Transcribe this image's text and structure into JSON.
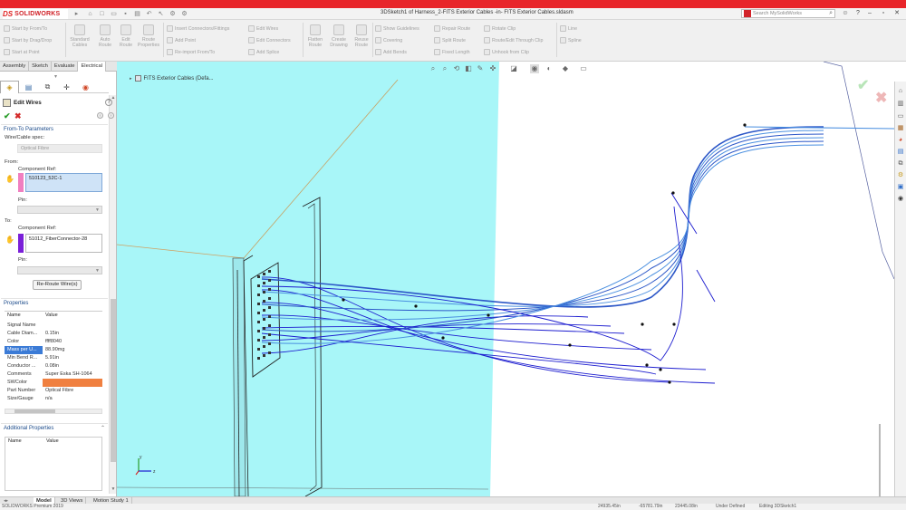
{
  "app": {
    "logo_mark": "DS",
    "logo_name": "SOLIDWORKS",
    "doc_title": "3DSketch1 of Harness_2-FITS Exterior Cables -in- FITS Exterior Cables.sldasm",
    "search_placeholder": "Search MySolidWorks",
    "search_icon": "magnifier-icon",
    "window_icons": [
      "user-icon",
      "help-icon",
      "minimize-icon",
      "restore-icon",
      "close-icon"
    ]
  },
  "commands": {
    "group1": [
      "Start by From/To",
      "Start by Drag/Drop",
      "Start at Point"
    ],
    "big1": [
      "Standard Cables",
      "Auto Route",
      "Edit Route",
      "Route Properties"
    ],
    "group2": [
      "Insert Connectors/Fittings",
      "Add Point",
      "Re-import From/To"
    ],
    "group3": [
      "Edit Wires",
      "Edit Connectors",
      "Add Splice"
    ],
    "big2": [
      "Flatten Route",
      "Create Drawing",
      "Reuse Route"
    ],
    "group4": [
      "Show Guidelines",
      "Covering",
      "Add Bends"
    ],
    "group5": [
      "Repair Route",
      "Split Route",
      "Fixed Length"
    ],
    "group6": [
      "Rotate Clip",
      "Route/Edit Through Clip",
      "Unhook from Clip"
    ],
    "group7": [
      "Line",
      "Spline"
    ]
  },
  "tabs": [
    "Assembly",
    "Sketch",
    "Evaluate",
    "Electrical"
  ],
  "active_tab": "Electrical",
  "pm": {
    "title": "Edit Wires",
    "from_to_section": "From-To Parameters",
    "wire_spec_label": "Wire/Cable spec:",
    "wire_spec_value": "Optical Fibre",
    "from_label": "From:",
    "from_comp_label": "Component Ref:",
    "from_comp_value": "510123_52C-1",
    "from_pin_label": "Pin:",
    "from_color": "#f07fc0",
    "to_label": "To:",
    "to_comp_label": "Component Ref:",
    "to_comp_value": "51012_FiberConnector-28",
    "to_pin_label": "Pin:",
    "to_color": "#7a1fd8",
    "reroute_button": "Re-Route Wire(s)",
    "properties_section": "Properties",
    "props_header": {
      "name": "Name",
      "value": "Value"
    },
    "props": [
      {
        "name": "Signal Name",
        "value": ""
      },
      {
        "name": "Cable Diam...",
        "value": "0.15in"
      },
      {
        "name": "Color",
        "value": "ffff8040"
      },
      {
        "name": "Mass per U...",
        "value": "88.90mg"
      },
      {
        "name": "Min Bend R...",
        "value": "5.91in"
      },
      {
        "name": "Conductor ...",
        "value": "0.08in"
      },
      {
        "name": "Comments",
        "value": "Super Eska SH-1064"
      },
      {
        "name": "SWColor",
        "value": ""
      },
      {
        "name": "Part Number",
        "value": "Optical Fibre"
      },
      {
        "name": "Size/Gauge",
        "value": "n/a"
      }
    ],
    "swcolor_swatch": "#f08040",
    "additional_section": "Additional Properties",
    "additional_header": {
      "name": "Name",
      "value": "Value"
    }
  },
  "viewport": {
    "tree_root": "FITS Exterior Cables  (Defa...",
    "background_left": "#a8f6f8",
    "wire_color": "#1c1ccf",
    "triad_labels": {
      "x": "z",
      "y": "y"
    }
  },
  "bottom_tabs": [
    "Model",
    "3D Views",
    "Motion Study 1"
  ],
  "active_bottom_tab": "Model",
  "status": {
    "left": "SOLIDWORKS Premium 2019",
    "c1": "24935.45in",
    "c2": "-65781.79in",
    "c3": "23445.08in",
    "c4": "Under Defined",
    "c5": "Editing 3DSketch1"
  }
}
